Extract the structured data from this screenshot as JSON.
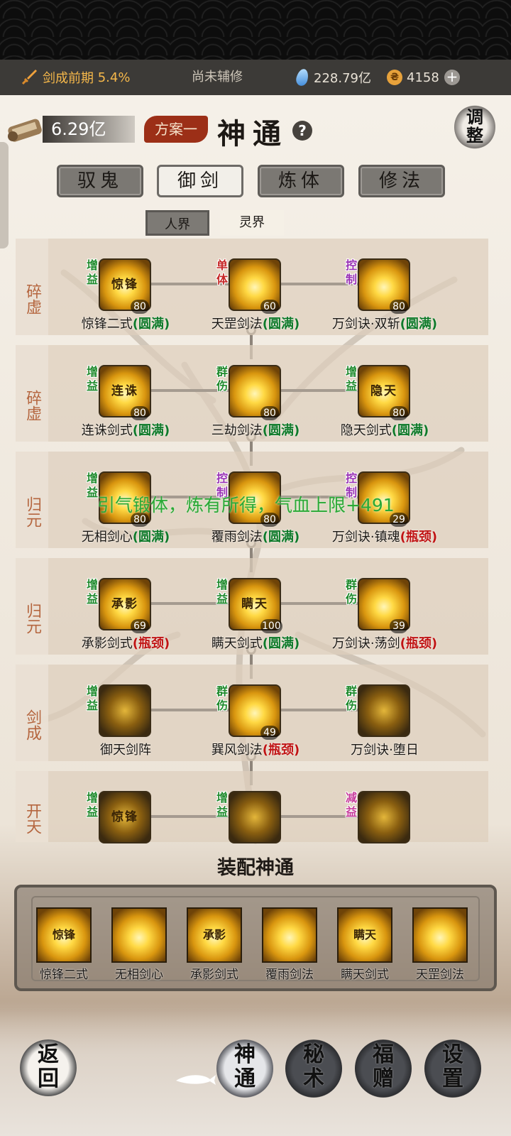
{
  "header": {
    "realm": "剑成前期",
    "realm_pct": "5.4%",
    "assist": "尚未辅修",
    "spirit_stones": "228.79亿",
    "coins": "4158",
    "plus": "+"
  },
  "top": {
    "scroll_value": "6.29亿",
    "plan": "方案一",
    "title": "神通",
    "help": "?",
    "adjust": "调整"
  },
  "categories": [
    "驭鬼",
    "御剑",
    "炼体",
    "修法"
  ],
  "active_category": "御剑",
  "worlds": [
    "人界",
    "灵界"
  ],
  "rows": [
    {
      "label": "碎虚",
      "nodes": [
        {
          "name": "惊锋二式",
          "status": "(圆满)",
          "status_type": "full",
          "tag": "增益",
          "tag_color": "green",
          "level": "80",
          "glyph": "惊锋"
        },
        {
          "name": "天罡剑法",
          "status": "(圆满)",
          "status_type": "full",
          "tag": "单体",
          "tag_color": "red",
          "level": "60",
          "glyph": ""
        },
        {
          "name": "万剑诀·双斩",
          "status": "(圆满)",
          "status_type": "full",
          "tag": "控制",
          "tag_color": "purple",
          "level": "80",
          "glyph": ""
        }
      ]
    },
    {
      "label": "碎虚",
      "nodes": [
        {
          "name": "连诛剑式",
          "status": "(圆满)",
          "status_type": "full",
          "tag": "增益",
          "tag_color": "green",
          "level": "80",
          "glyph": "连诛"
        },
        {
          "name": "三劫剑法",
          "status": "(圆满)",
          "status_type": "full",
          "tag": "群伤",
          "tag_color": "green",
          "level": "80",
          "glyph": ""
        },
        {
          "name": "隐天剑式",
          "status": "(圆满)",
          "status_type": "full",
          "tag": "增益",
          "tag_color": "green",
          "level": "80",
          "glyph": "隐天"
        }
      ]
    },
    {
      "label": "归元",
      "nodes": [
        {
          "name": "无相剑心",
          "status": "(圆满)",
          "status_type": "full",
          "tag": "增益",
          "tag_color": "green",
          "level": "80",
          "glyph": ""
        },
        {
          "name": "覆雨剑法",
          "status": "(圆满)",
          "status_type": "full",
          "tag": "控制",
          "tag_color": "purple",
          "level": "80",
          "glyph": ""
        },
        {
          "name": "万剑诀·镇魂",
          "status": "(瓶颈)",
          "status_type": "bottle",
          "tag": "控制",
          "tag_color": "purple",
          "level": "29",
          "glyph": ""
        }
      ]
    },
    {
      "label": "归元",
      "nodes": [
        {
          "name": "承影剑式",
          "status": "(瓶颈)",
          "status_type": "bottle",
          "tag": "增益",
          "tag_color": "green",
          "level": "69",
          "glyph": "承影"
        },
        {
          "name": "瞒天剑式",
          "status": "(圆满)",
          "status_type": "full",
          "tag": "增益",
          "tag_color": "green",
          "level": "100",
          "glyph": "瞒天"
        },
        {
          "name": "万剑诀·荡剑",
          "status": "(瓶颈)",
          "status_type": "bottle",
          "tag": "群伤",
          "tag_color": "green",
          "level": "39",
          "glyph": ""
        }
      ]
    },
    {
      "label": "剑成",
      "nodes": [
        {
          "name": "御天剑阵",
          "status": "",
          "status_type": "",
          "tag": "增益",
          "tag_color": "green",
          "level": "",
          "glyph": ""
        },
        {
          "name": "巽风剑法",
          "status": "(瓶颈)",
          "status_type": "bottle",
          "tag": "群伤",
          "tag_color": "green",
          "level": "49",
          "glyph": ""
        },
        {
          "name": "万剑诀·堕日",
          "status": "",
          "status_type": "",
          "tag": "群伤",
          "tag_color": "green",
          "level": "",
          "glyph": ""
        }
      ]
    },
    {
      "label": "开天",
      "nodes": [
        {
          "name": "",
          "status": "",
          "status_type": "",
          "tag": "增益",
          "tag_color": "green",
          "level": "",
          "glyph": "惊锋"
        },
        {
          "name": "",
          "status": "",
          "status_type": "",
          "tag": "增益",
          "tag_color": "green",
          "level": "",
          "glyph": ""
        },
        {
          "name": "",
          "status": "",
          "status_type": "",
          "tag": "减益",
          "tag_color": "pink",
          "level": "",
          "glyph": ""
        }
      ]
    }
  ],
  "float_message": "引气锻体，炼有所得，气血上限+491",
  "equip": {
    "title": "装配神通",
    "items": [
      {
        "name": "惊锋二式",
        "glyph": "惊锋"
      },
      {
        "name": "无相剑心",
        "glyph": ""
      },
      {
        "name": "承影剑式",
        "glyph": "承影"
      },
      {
        "name": "覆雨剑法",
        "glyph": ""
      },
      {
        "name": "瞒天剑式",
        "glyph": "瞒天"
      },
      {
        "name": "天罡剑法",
        "glyph": ""
      }
    ]
  },
  "nav": {
    "back": "返回",
    "items": [
      "神通",
      "秘术",
      "福赠",
      "设置"
    ],
    "active": "神通"
  }
}
